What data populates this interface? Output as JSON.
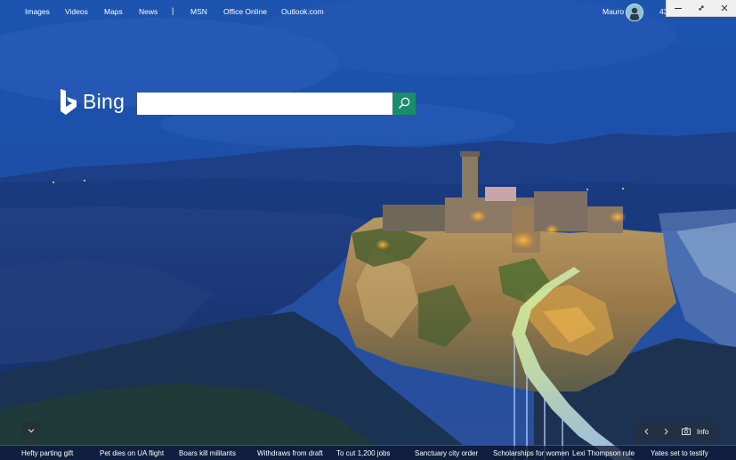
{
  "nav": {
    "links": [
      "Images",
      "Videos",
      "Maps",
      "News"
    ],
    "separator": "|",
    "links2": [
      "MSN",
      "Office Online",
      "Outlook.com"
    ]
  },
  "account": {
    "name": "Mauro",
    "points": "43"
  },
  "brand": {
    "name": "Bing",
    "accent": "#1a8d6c"
  },
  "search": {
    "value": "",
    "placeholder": ""
  },
  "image_controls": {
    "info_label": "Info"
  },
  "headlines": [
    "Hefty parting gift",
    "Pet dies on UA flight",
    "Boars kill militants",
    "Withdraws from draft",
    "To cut 1,200 jobs",
    "Sanctuary city order",
    "Scholarships for women",
    "Lexi Thompson rule",
    "Yates set to testify"
  ]
}
